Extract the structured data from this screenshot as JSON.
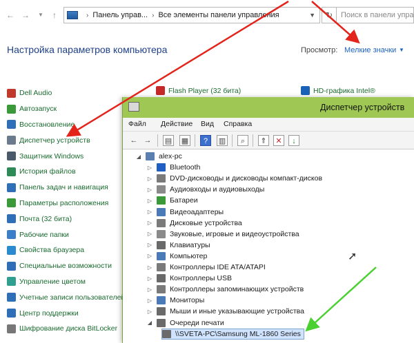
{
  "address_bar": {
    "segments": [
      "Панель управ...",
      "Все элементы панели управления"
    ],
    "search_placeholder": "Поиск в панели управления"
  },
  "header": {
    "title": "Настройка параметров компьютера",
    "view_label": "Просмотр:",
    "view_value": "Мелкие значки"
  },
  "top_items": [
    "Flash Player (32 бита)",
    "HD-графика Intel®"
  ],
  "cp_items": [
    {
      "label": "Dell Audio",
      "color": "#c0392b"
    },
    {
      "label": "Автозапуск",
      "color": "#3a9a3a"
    },
    {
      "label": "Восстановление",
      "color": "#2f6fb8"
    },
    {
      "label": "Диспетчер устройств",
      "color": "#6b7a8c"
    },
    {
      "label": "Защитник Windows",
      "color": "#4a5a6a"
    },
    {
      "label": "История файлов",
      "color": "#2e8b57"
    },
    {
      "label": "Панель задач и навигация",
      "color": "#2f6fb8"
    },
    {
      "label": "Параметры расположения",
      "color": "#3a9a3a"
    },
    {
      "label": "Почта (32 бита)",
      "color": "#2f6fb8"
    },
    {
      "label": "Рабочие папки",
      "color": "#3a7fc8"
    },
    {
      "label": "Свойства браузера",
      "color": "#2a8ad0"
    },
    {
      "label": "Специальные возможности",
      "color": "#2f6fb8"
    },
    {
      "label": "Управление цветом",
      "color": "#2f9f8f"
    },
    {
      "label": "Учетные записи пользователей",
      "color": "#2f6fb8"
    },
    {
      "label": "Центр поддержки",
      "color": "#2f6fb8"
    },
    {
      "label": "Шифрование диска BitLocker",
      "color": "#777777"
    }
  ],
  "device_manager": {
    "title": "Диспетчер устройств",
    "menu": [
      "Файл",
      "Действие",
      "Вид",
      "Справка"
    ],
    "root": "alex-pc",
    "devices": [
      {
        "label": "Bluetooth",
        "color": "#1f5fc4"
      },
      {
        "label": "DVD-дисководы и дисководы компакт-дисков",
        "color": "#7a7a7a"
      },
      {
        "label": "Аудиовходы и аудиовыходы",
        "color": "#8a8a8a"
      },
      {
        "label": "Батареи",
        "color": "#3a9a3a"
      },
      {
        "label": "Видеоадаптеры",
        "color": "#4a7ab8"
      },
      {
        "label": "Дисковые устройства",
        "color": "#7a7a7a"
      },
      {
        "label": "Звуковые, игровые и видеоустройства",
        "color": "#8a8a8a"
      },
      {
        "label": "Клавиатуры",
        "color": "#6a6a6a"
      },
      {
        "label": "Компьютер",
        "color": "#4a7ab8"
      },
      {
        "label": "Контроллеры IDE ATA/ATAPI",
        "color": "#7a7a7a"
      },
      {
        "label": "Контроллеры USB",
        "color": "#6a6a6a"
      },
      {
        "label": "Контроллеры запоминающих устройств",
        "color": "#7a7a7a"
      },
      {
        "label": "Мониторы",
        "color": "#4a7ab8"
      },
      {
        "label": "Мыши и иные указывающие устройства",
        "color": "#6a6a6a"
      },
      {
        "label": "Очереди печати",
        "color": "#6a6a6a"
      }
    ],
    "selected_child": "\\\\SVETA-PC\\Samsung ML-1860 Series"
  },
  "colors": {
    "titlebar": "#9fc754",
    "link": "#1e63c0",
    "cp_text": "#1a6b2f",
    "annotation_red": "#e3241b",
    "annotation_green": "#4ad030"
  }
}
